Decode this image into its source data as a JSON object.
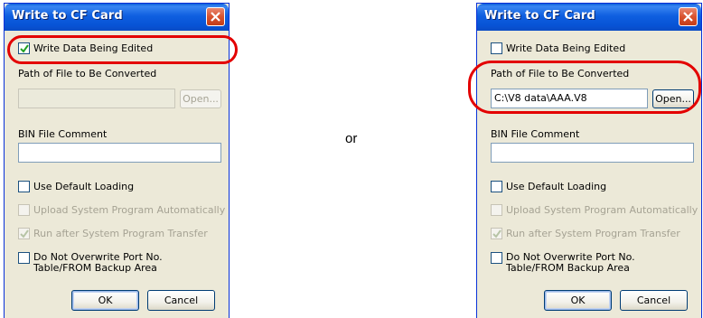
{
  "separator": "or",
  "colors": {
    "title_bar": "#0a5ed8",
    "dialog_bg": "#ece9d8",
    "highlight": "#e30000",
    "disabled_text": "#a6a394"
  },
  "dialogs": [
    {
      "title": "Write to CF Card",
      "write_data_being_edited": {
        "label": "Write Data Being Edited",
        "checked": true
      },
      "path_label": "Path of File to Be Converted",
      "path_value": "",
      "path_enabled": false,
      "open_label": "Open...",
      "bin_comment_label": "BIN File Comment",
      "bin_comment_value": "",
      "use_default_loading": {
        "label": "Use Default Loading",
        "checked": false
      },
      "upload_auto": {
        "label": "Upload System Program Automatically",
        "checked": false,
        "enabled": false
      },
      "run_after": {
        "label": "Run after System Program Transfer",
        "checked": true,
        "enabled": false
      },
      "do_not_overwrite": {
        "label_line1": "Do Not Overwrite Port No.",
        "label_line2": "Table/FROM Backup Area",
        "checked": false
      },
      "ok_label": "OK",
      "cancel_label": "Cancel",
      "close_icon": "close-icon"
    },
    {
      "title": "Write to CF Card",
      "write_data_being_edited": {
        "label": "Write Data Being Edited",
        "checked": false
      },
      "path_label": "Path of File to Be Converted",
      "path_value": "C:\\V8 data\\AAA.V8",
      "path_enabled": true,
      "open_label": "Open...",
      "bin_comment_label": "BIN File Comment",
      "bin_comment_value": "",
      "use_default_loading": {
        "label": "Use Default Loading",
        "checked": false
      },
      "upload_auto": {
        "label": "Upload System Program Automatically",
        "checked": false,
        "enabled": false
      },
      "run_after": {
        "label": "Run after System Program Transfer",
        "checked": true,
        "enabled": false
      },
      "do_not_overwrite": {
        "label_line1": "Do Not Overwrite Port No.",
        "label_line2": "Table/FROM Backup Area",
        "checked": false
      },
      "ok_label": "OK",
      "cancel_label": "Cancel",
      "close_icon": "close-icon"
    }
  ]
}
